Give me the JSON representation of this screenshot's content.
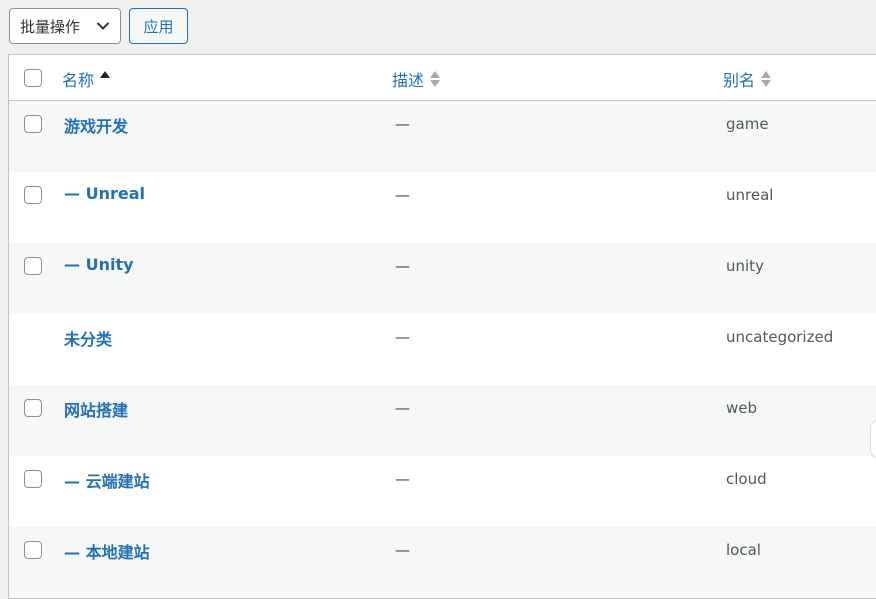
{
  "toolbar": {
    "bulk_actions_label": "批量操作",
    "apply_label": "应用"
  },
  "table": {
    "columns": {
      "name": "名称",
      "description": "描述",
      "slug": "别名"
    },
    "sorted_column": "name",
    "rows": [
      {
        "name": "游戏开发",
        "description": "—",
        "slug": "game",
        "has_checkbox": true
      },
      {
        "name": "— Unreal",
        "description": "—",
        "slug": "unreal",
        "has_checkbox": true
      },
      {
        "name": "— Unity",
        "description": "—",
        "slug": "unity",
        "has_checkbox": true
      },
      {
        "name": "未分类",
        "description": "—",
        "slug": "uncategorized",
        "has_checkbox": false
      },
      {
        "name": "网站搭建",
        "description": "—",
        "slug": "web",
        "has_checkbox": true
      },
      {
        "name": "— 云端建站",
        "description": "—",
        "slug": "cloud",
        "has_checkbox": true
      },
      {
        "name": "— 本地建站",
        "description": "—",
        "slug": "local",
        "has_checkbox": true
      }
    ]
  },
  "colors": {
    "link": "#2271b1",
    "row_alt": "#f6f7f7",
    "border": "#c3c4c7"
  }
}
